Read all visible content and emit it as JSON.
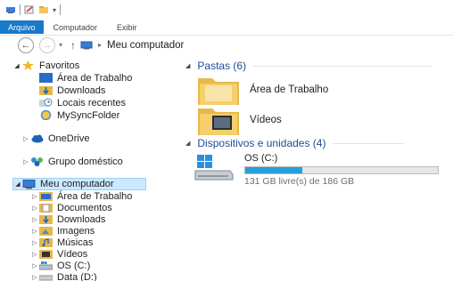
{
  "ribbon": {
    "tabs": [
      "Arquivo",
      "Computador",
      "Exibir"
    ]
  },
  "address": {
    "path": "Meu computador"
  },
  "nav": {
    "favorites": {
      "label": "Favoritos",
      "items": [
        "Área de Trabalho",
        "Downloads",
        "Locais recentes",
        "MySyncFolder"
      ]
    },
    "onedrive": "OneDrive",
    "homegroup": "Grupo doméstico",
    "computer": {
      "label": "Meu computador",
      "items": [
        "Área de Trabalho",
        "Documentos",
        "Downloads",
        "Imagens",
        "Músicas",
        "Vídeos",
        "OS (C:)",
        "Data (D:)"
      ]
    }
  },
  "main": {
    "folders_header": "Pastas (6)",
    "folders": [
      "Área de Trabalho",
      "Vídeos"
    ],
    "devices_header": "Dispositivos e unidades (4)",
    "drive": {
      "name": "OS (C:)",
      "free_text": "131 GB livre(s) de 186 GB",
      "used_fraction": 0.296
    }
  },
  "colors": {
    "accent": "#1979ca",
    "selection": "#cce8ff",
    "group_header": "#1e4c9a",
    "drive_bar": "#26a0da"
  }
}
